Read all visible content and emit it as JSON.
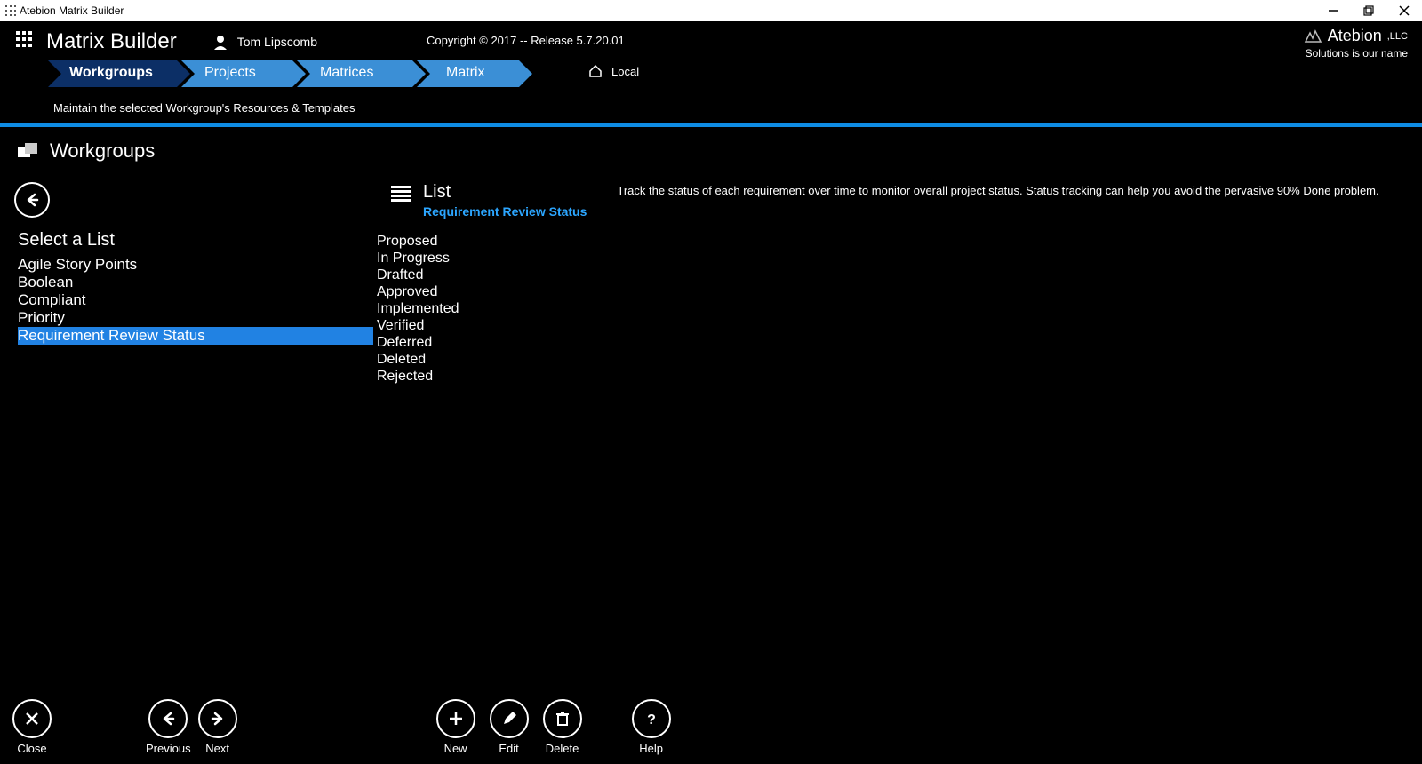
{
  "window": {
    "title": "Atebion Matrix Builder"
  },
  "header": {
    "app_title": "Matrix Builder",
    "user_name": "Tom Lipscomb",
    "copyright": "Copyright © 2017 -- Release 5.7.20.01",
    "brand_name": "Atebion",
    "brand_suffix": ",LLC",
    "brand_tag": "Solutions is our name"
  },
  "breadcrumbs": {
    "items": [
      "Workgroups",
      "Projects",
      "Matrices",
      "Matrix"
    ],
    "location_label": "Local"
  },
  "sub_description": "Maintain the selected Workgroup's Resources & Templates",
  "section_title": "Workgroups",
  "sidebar": {
    "title": "Select a List",
    "items": [
      {
        "label": "Agile Story Points",
        "selected": false
      },
      {
        "label": "Boolean",
        "selected": false
      },
      {
        "label": "Compliant",
        "selected": false
      },
      {
        "label": "Priority",
        "selected": false
      },
      {
        "label": "Requirement Review Status",
        "selected": true
      }
    ]
  },
  "detail": {
    "heading": "List",
    "subheading": "Requirement Review Status",
    "description": "Track the status of each requirement over time to monitor overall project status. Status tracking can help you avoid the pervasive 90% Done problem.",
    "values": [
      "Proposed",
      "In Progress",
      "Drafted",
      "Approved",
      "Implemented",
      "Verified",
      "Deferred",
      "Deleted",
      "Rejected"
    ]
  },
  "footer": {
    "close": "Close",
    "previous": "Previous",
    "next": "Next",
    "new": "New",
    "edit": "Edit",
    "delete": "Delete",
    "help": "Help"
  }
}
